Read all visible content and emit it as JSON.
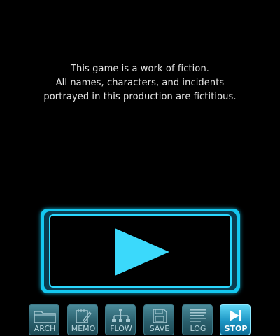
{
  "disclaimer": {
    "line1": "This game is a work of fiction.",
    "line2": "All names, characters, and incidents",
    "line3": "portrayed in this production are fictitious."
  },
  "play_button": {
    "icon": "play-icon",
    "color": "#14c8f0"
  },
  "toolbar": {
    "items": [
      {
        "label": "ARCH",
        "icon": "folder-icon",
        "active": false
      },
      {
        "label": "MEMO",
        "icon": "notepad-pen-icon",
        "active": false
      },
      {
        "label": "FLOW",
        "icon": "flowchart-icon",
        "active": false
      },
      {
        "label": "SAVE",
        "icon": "floppy-disk-icon",
        "active": false
      },
      {
        "label": "LOG",
        "icon": "log-list-icon",
        "active": false
      },
      {
        "label": "STOP",
        "icon": "skip-forward-icon",
        "active": true
      }
    ]
  },
  "colors": {
    "background": "#000000",
    "accent": "#14c8f0",
    "toolbar_button": "#2a5f6c",
    "toolbar_active": "#1b95c4"
  }
}
